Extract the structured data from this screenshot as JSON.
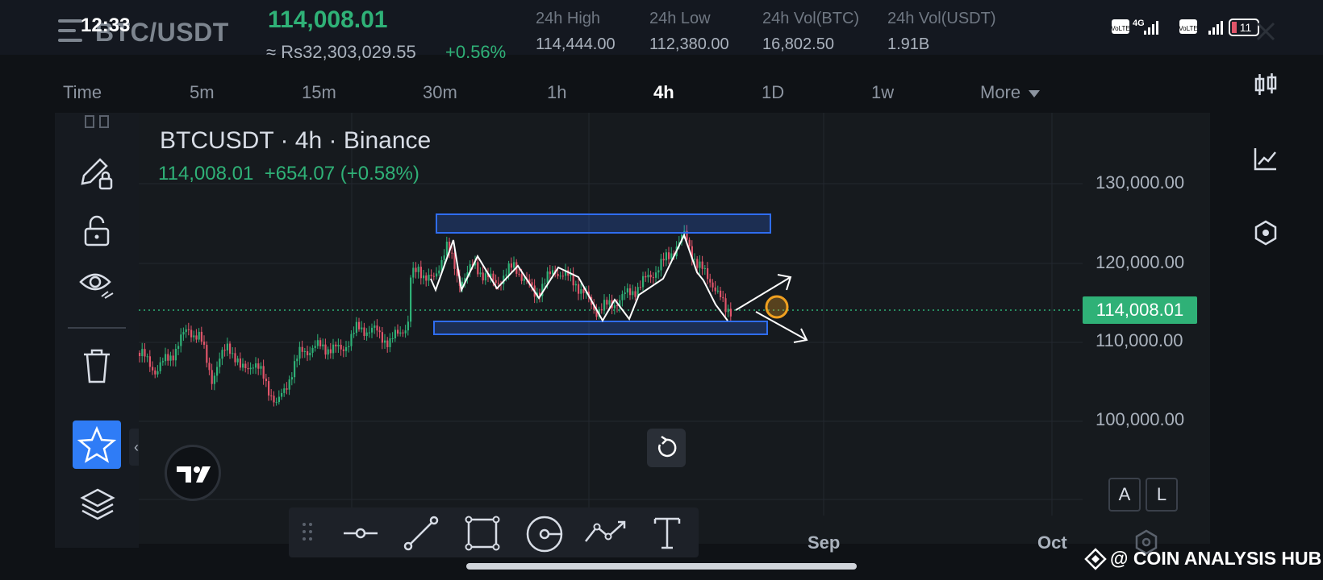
{
  "status": {
    "time": "12:33",
    "network": "4G",
    "battery": "11"
  },
  "header": {
    "pair": "BTC/USDT",
    "last_price": "114,008.01",
    "price_inr": "≈ Rs32,303,029.55",
    "change_pct": "+0.56%",
    "stats": [
      {
        "label": "24h High",
        "value": "114,444.00"
      },
      {
        "label": "24h Low",
        "value": "112,380.00"
      },
      {
        "label": "24h Vol(BTC)",
        "value": "16,802.50"
      },
      {
        "label": "24h Vol(USDT)",
        "value": "1.91B"
      }
    ]
  },
  "timeframes": {
    "items": [
      "Time",
      "5m",
      "15m",
      "30m",
      "1h",
      "4h",
      "1D",
      "1w",
      "More"
    ],
    "active": "4h"
  },
  "chart": {
    "title": "BTCUSDT · 4h · Binance",
    "last": "114,008.01",
    "change": "+654.07 (+0.58%)",
    "y_ticks": [
      "130,000.00",
      "120,000.00",
      "110,000.00",
      "100,000.00"
    ],
    "price_tag": "114,008.01",
    "x_ticks": [
      "Sep",
      "Oct"
    ],
    "scale_buttons": [
      "A",
      "L"
    ]
  },
  "watermark": "@ COIN ANALYSIS HUB",
  "colors": {
    "up": "#2fb177",
    "down": "#e0556a",
    "accent": "#2f7cf6",
    "box": "#2f6df0",
    "marker": "#f0a020"
  },
  "icons": {
    "right_rail": [
      "candles-icon",
      "indicator-chart-icon",
      "hexagon-settings-icon"
    ],
    "left_tools": [
      "pencil-lock-icon",
      "unlock-icon",
      "eye-icon",
      "trash-icon",
      "star-icon",
      "layers-icon"
    ],
    "draw_bar": [
      "drag-handle-icon",
      "horizontal-line-icon",
      "trend-line-icon",
      "rectangle-icon",
      "circle-icon",
      "path-icon",
      "text-icon"
    ]
  }
}
